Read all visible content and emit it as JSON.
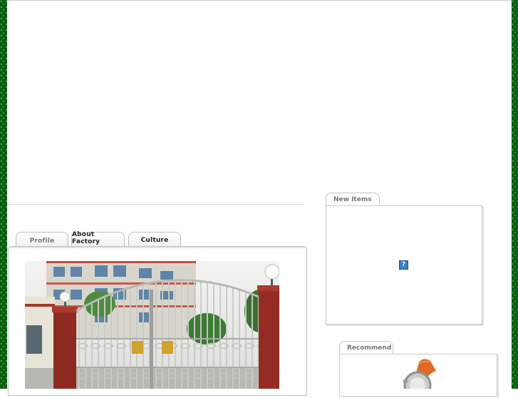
{
  "tabs": [
    {
      "label": "Profile"
    },
    {
      "label": "About Factory"
    },
    {
      "label": "Culture"
    }
  ],
  "sidebar": {
    "new_items": {
      "title": "New Items",
      "placeholder_icon": "broken-image-help-icon",
      "icon_glyph": "?"
    },
    "recommend": {
      "title": "Recommend"
    }
  },
  "colors": {
    "border_green": "#0a5a12",
    "tab_border": "#bdbdbd",
    "link_blue": "#3b7fc5"
  }
}
